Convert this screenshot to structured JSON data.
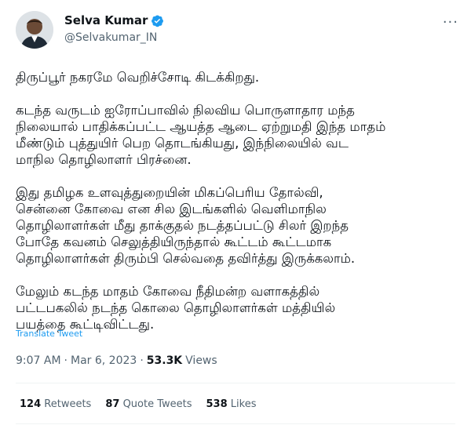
{
  "author": {
    "display_name": "Selva Kumar",
    "handle": "@Selvakumar_IN",
    "verified_icon": "verified-badge-icon",
    "verified_color": "#1d9bf0"
  },
  "more_icon": "more-options-icon",
  "tweet": {
    "paragraphs": [
      "திருப்பூர் நகரமே வெறிச்சோடி கிடக்கிறது.",
      "கடந்த வருடம் ஐரோப்பாவில் நிலவிய பொருளாதார மந்த\nநிலையால் பாதிக்கப்பட்ட ஆயத்த ஆடை ஏற்றுமதி இந்த மாதம்\nமீண்டும் புத்துயிர் பெற தொடங்கியது, இந்நிலையில் வட\nமாநில தொழிலாளர் பிரச்னை.",
      "இது தமிழக உளவுத்துறையின் மிகப்பெரிய தோல்வி,\nசென்னை கோவை என சில இடங்களில் வெளிமாநில\nதொழிலாளர்கள் மீது தாக்குதல் நடத்தப்பட்டு சிலர் இறந்த\nபோதே கவனம் செலுத்தியிருந்தால் கூட்டம் கூட்டமாக\nதொழிலாளர்கள் திரும்பி செல்வதை தவிர்த்து இருக்கலாம்.",
      "மேலும் கடந்த மாதம் கோவை நீதிமன்ற வளாகத்தில்\nபட்டபகலில் நடந்த கொலை தொழிலாளர்கள் மத்தியில்\nபயத்தை கூட்டிவிட்டது."
    ],
    "translate_label": "Translate Tweet",
    "time": "9:07 AM",
    "date": "Mar 6, 2023",
    "views_count": "53.3K",
    "views_label": "Views"
  },
  "stats": {
    "retweets_count": "124",
    "retweets_label": "Retweets",
    "quotes_count": "87",
    "quotes_label": "Quote Tweets",
    "likes_count": "538",
    "likes_label": "Likes"
  }
}
